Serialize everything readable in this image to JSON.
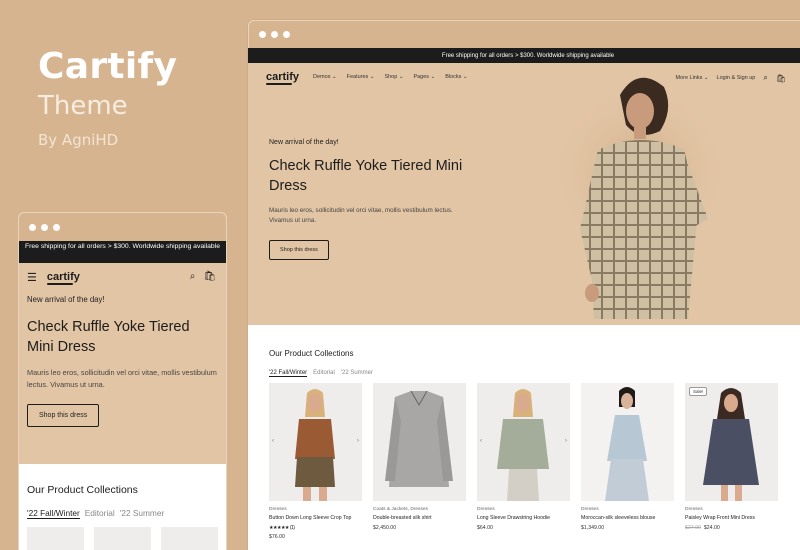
{
  "brand": {
    "title": "Cartify",
    "subtitle": "Theme",
    "byline": "By AgniHD"
  },
  "announcement": "Free shipping for all orders > $300. Worldwide shipping available",
  "logo": "cartify",
  "nav": {
    "menu": [
      "Demos",
      "Features",
      "Shop",
      "Pages",
      "Blocks"
    ],
    "more_links": "More Links",
    "login": "Login & Sign up",
    "cart_count": "0"
  },
  "hero": {
    "kicker": "New arrival of the day!",
    "title": "Check Ruffle Yoke Tiered Mini Dress",
    "description": "Mauris leo eros, sollicitudin vel orci vitae, mollis vestibulum lectus. Vivamus ut urna.",
    "cta": "Shop this dress"
  },
  "collections": {
    "title": "Our Product Collections",
    "tabs": [
      "'22 Fall/Winter",
      "Editorial",
      "'22 Summer"
    ]
  },
  "products": [
    {
      "category": "Dresses",
      "name": "Button Down Long Sleeve Crop Top",
      "price": "$76.00",
      "old_price": "",
      "rating": "★★★★★",
      "rating_count": "(1)",
      "badge": ""
    },
    {
      "category": "Coats & Jackets, Dresses",
      "name": "Double-breasted silk shirt",
      "price": "$2,450.00",
      "old_price": "",
      "rating": "",
      "rating_count": "",
      "badge": ""
    },
    {
      "category": "Dresses",
      "name": "Long Sleeve Drawstring Hoodie",
      "price": "$64.00",
      "old_price": "",
      "rating": "",
      "rating_count": "",
      "badge": ""
    },
    {
      "category": "Dresses",
      "name": "Moroccan-silk sleeveless blouse",
      "price": "$1,349.00",
      "old_price": "",
      "rating": "",
      "rating_count": "",
      "badge": ""
    },
    {
      "category": "Dresses",
      "name": "Paisley Wrap Front Mini Dress",
      "price": "$24.00",
      "old_price": "$27.00",
      "rating": "",
      "rating_count": "",
      "badge": "Sale!"
    }
  ]
}
